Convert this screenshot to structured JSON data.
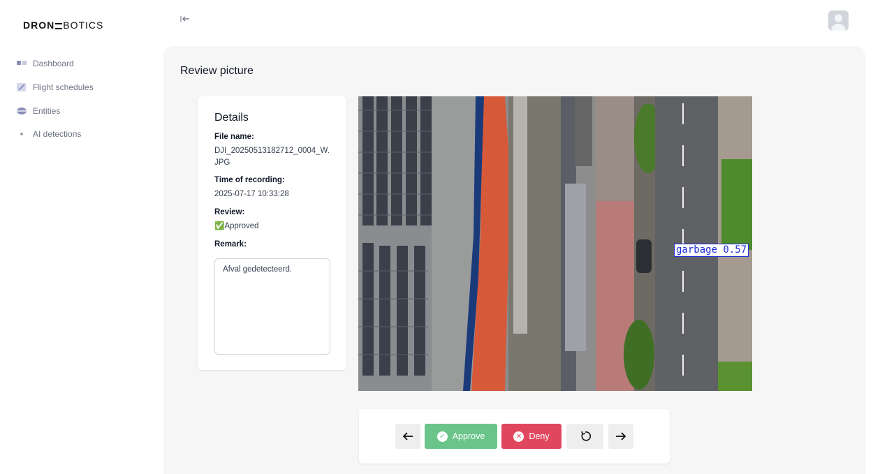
{
  "brand": {
    "logo_bold": "DRON",
    "logo_light": "BOTICS"
  },
  "sidebar": {
    "items": [
      {
        "label": "Dashboard",
        "icon": "dashboard-icon"
      },
      {
        "label": "Flight schedules",
        "icon": "flight-schedules-icon"
      },
      {
        "label": "Entities",
        "icon": "entities-icon"
      },
      {
        "label": "AI detections",
        "icon": "dot-icon"
      }
    ]
  },
  "header": {
    "collapse_icon": "collapse-left-icon",
    "avatar_icon": "user-avatar-icon"
  },
  "page": {
    "title": "Review picture"
  },
  "details": {
    "title": "Details",
    "file_name_label": "File name:",
    "file_name": "DJI_20250513182712_0004_W.JPG",
    "time_label": "Time of recording:",
    "time": "2025-07-17 10:33:28",
    "review_label": "Review:",
    "review_value": "✅Approved",
    "remark_label": "Remark:",
    "remark": "Afval gedetecteerd."
  },
  "image": {
    "detection_label": "garbage 0.57",
    "detection_color": "#1d2bd8"
  },
  "actions": {
    "approve_label": "Approve",
    "deny_label": "Deny",
    "approve_color": "#6bc58a",
    "deny_color": "#e0475f"
  }
}
